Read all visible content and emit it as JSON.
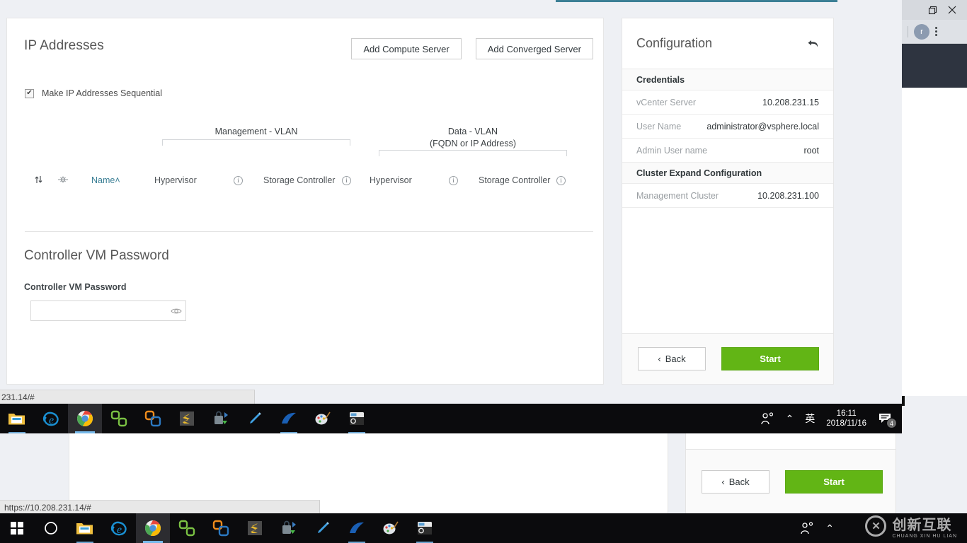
{
  "window": {
    "restore_icon": "restore-icon",
    "close_icon": "close-icon",
    "tab_accent_color": "#3b7f95"
  },
  "chrome_fragment": {
    "avatar_letter": "r",
    "menu_icon": "kebab-menu-icon"
  },
  "main": {
    "section_title": "IP Addresses",
    "buttons": {
      "add_compute": "Add Compute Server",
      "add_converged": "Add Converged Server"
    },
    "sequential_checkbox": {
      "label": "Make IP Addresses Sequential",
      "checked": true,
      "mark": "✔"
    },
    "column_groups": [
      {
        "id": "management",
        "label_line1": "Management - VLAN",
        "label_line2": ""
      },
      {
        "id": "data",
        "label_line1": "Data - VLAN",
        "label_line2": "(FQDN or IP Address)"
      }
    ],
    "table_headers": {
      "sort_icon": "sort-icon",
      "settings_icon": "column-settings-icon",
      "name": "Name",
      "name_sort_indicator": "˄",
      "mgmt_hypervisor": "Hypervisor",
      "mgmt_storage_controller": "Storage Controller",
      "data_hypervisor": "Hypervisor",
      "data_storage_controller": "Storage Controller",
      "info_icon": "i"
    },
    "password_section": {
      "title": "Controller VM Password",
      "field_label": "Controller VM Password",
      "value": "",
      "placeholder": "",
      "reveal_icon": "eye-icon"
    }
  },
  "config_panel": {
    "title": "Configuration",
    "undo_icon": "undo-arrow-icon",
    "groups": [
      {
        "header": "Credentials",
        "rows": [
          {
            "key": "vCenter Server",
            "value": "10.208.231.15"
          },
          {
            "key": "User Name",
            "value": "administrator@vsphere.local"
          },
          {
            "key": "Admin User name",
            "value": "root"
          }
        ]
      },
      {
        "header": "Cluster Expand Configuration",
        "rows": [
          {
            "key": "Management Cluster",
            "value": "10.208.231.100"
          }
        ]
      }
    ],
    "footer": {
      "back_label": "Back",
      "back_chevron": "‹",
      "start_label": "Start",
      "start_color": "#62b515"
    }
  },
  "status_bars": {
    "top_tip": "231.14/#",
    "bottom_tip": "https://10.208.231.14/#"
  },
  "taskbar": {
    "start_icon": "windows-start-icon",
    "search_icon": "cortana-circle-icon",
    "apps": [
      {
        "name": "file-explorer-icon",
        "label": "File Explorer",
        "state": "running"
      },
      {
        "name": "internet-explorer-icon",
        "label": "Internet Explorer",
        "state": "idle"
      },
      {
        "name": "google-chrome-icon",
        "label": "Google Chrome",
        "state": "active"
      },
      {
        "name": "vmware-remote-console-icon",
        "label": "VMware Remote Console",
        "state": "idle"
      },
      {
        "name": "vmware-workstation-icon",
        "label": "VMware Workstation",
        "state": "idle"
      },
      {
        "name": "sublime-text-icon",
        "label": "Sublime Text",
        "state": "idle"
      },
      {
        "name": "secure-crt-icon",
        "label": "SecureCRT",
        "state": "idle"
      },
      {
        "name": "pen-tool-icon",
        "label": "Snipping Tool",
        "state": "idle"
      },
      {
        "name": "wireshark-icon",
        "label": "Wireshark",
        "state": "running"
      },
      {
        "name": "paint-icon",
        "label": "Paint",
        "state": "idle"
      },
      {
        "name": "putty-icon",
        "label": "PuTTY",
        "state": "running"
      }
    ],
    "tray": {
      "people_icon": "people-share-icon",
      "chevron_icon": "⌃",
      "ime": "英",
      "time": "16:11",
      "date": "2018/11/16",
      "notification_icon": "notification-icon",
      "notification_count": "4"
    }
  },
  "watermark": {
    "logo_letter": "✕",
    "text_cn": "创新互联",
    "text_en": "CHUANG XIN HU LIAN"
  }
}
